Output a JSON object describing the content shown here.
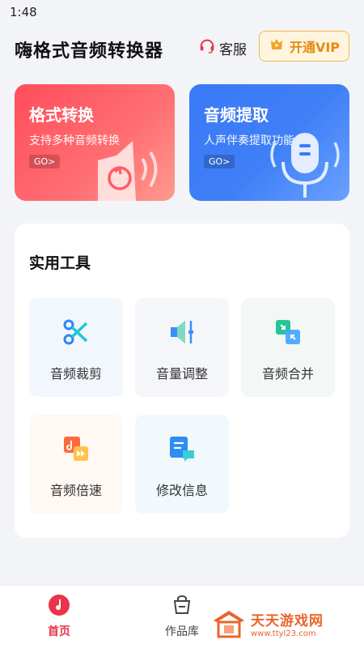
{
  "status_bar": {
    "time": "1:48"
  },
  "header": {
    "title": "嗨格式音频转换器",
    "service_label": "客服",
    "vip_label": "开通VIP"
  },
  "features": [
    {
      "title": "格式转换",
      "subtitle": "支持多种音频转换",
      "go": "GO>",
      "color": "#ff4d5a"
    },
    {
      "title": "音频提取",
      "subtitle": "人声伴奏提取功能",
      "go": "GO>",
      "color": "#3a79f7"
    }
  ],
  "tools": {
    "title": "实用工具",
    "items": [
      {
        "label": "音频裁剪",
        "icon": "scissors-icon"
      },
      {
        "label": "音量调整",
        "icon": "volume-adjust-icon"
      },
      {
        "label": "音频合并",
        "icon": "merge-icon"
      },
      {
        "label": "音频倍速",
        "icon": "speed-icon"
      },
      {
        "label": "修改信息",
        "icon": "edit-info-icon"
      }
    ]
  },
  "bottom_nav": {
    "items": [
      {
        "label": "首页",
        "icon": "music-note-icon",
        "active": true
      },
      {
        "label": "作品库",
        "icon": "bag-icon",
        "active": false
      }
    ]
  },
  "watermark": {
    "name": "天天游戏网",
    "url": "www.ttyl23.com"
  },
  "colors": {
    "accent": "#e9344a",
    "vip": "#e48a12",
    "blue": "#3a79f7"
  }
}
